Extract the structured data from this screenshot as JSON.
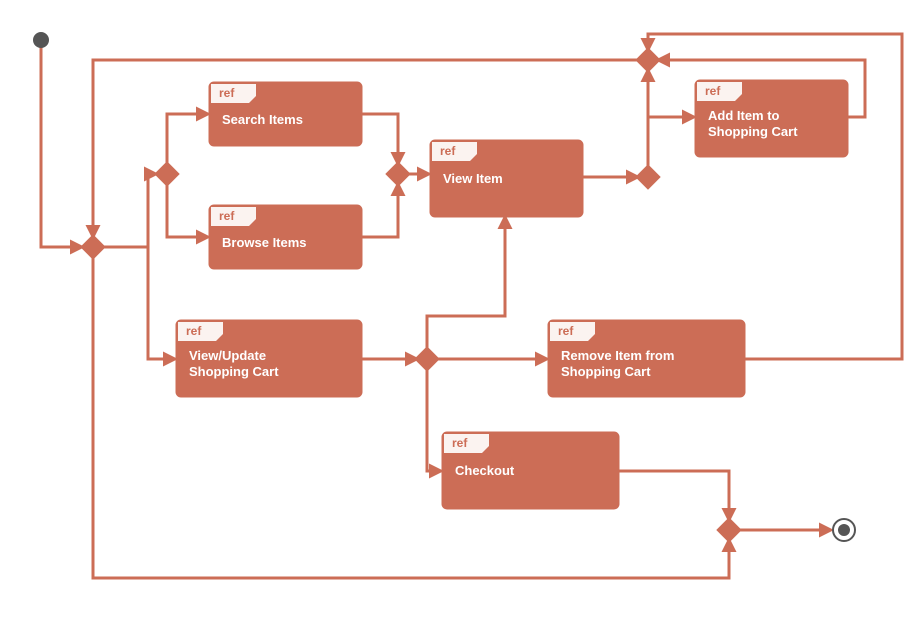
{
  "diagram": {
    "type": "uml-activity",
    "color": "#cc6d56",
    "refTag": "ref",
    "nodes": {
      "search": {
        "label": "Search Items"
      },
      "browse": {
        "label": "Browse Items"
      },
      "viewItem": {
        "label": "View Item"
      },
      "addItem1": {
        "label1": "Add Item to",
        "label2": "Shopping Cart"
      },
      "viewCart1": {
        "label1": "View/Update",
        "label2": "Shopping Cart"
      },
      "remove1": {
        "label1": "Remove Item from",
        "label2": "Shopping Cart"
      },
      "checkout": {
        "label": "Checkout"
      }
    }
  }
}
